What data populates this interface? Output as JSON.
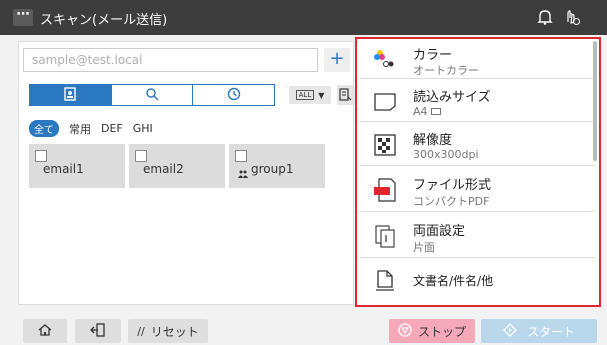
{
  "header": {
    "menu_label": "⋯",
    "title": "スキャン(メール送信)",
    "icons": [
      "bell-icon",
      "touch-info-icon"
    ]
  },
  "address": {
    "placeholder": "sample@test.local",
    "add_label": "+"
  },
  "tabs": [
    {
      "icon": "address-book-icon",
      "active": true
    },
    {
      "icon": "search-icon",
      "active": false
    },
    {
      "icon": "history-icon",
      "active": false
    }
  ],
  "view_select": {
    "box": "ALL",
    "arrow": "▼"
  },
  "filters": [
    "全て",
    "常用",
    "DEF",
    "GHI"
  ],
  "destinations": [
    {
      "label": "email1"
    },
    {
      "label": "email2"
    },
    {
      "label": "group1",
      "icon": "group-icon"
    }
  ],
  "settings": [
    {
      "label": "カラー",
      "value": "オートカラー",
      "icon": "color-icon"
    },
    {
      "label": "読込みサイズ",
      "value": "A4",
      "icon": "paper-size-icon"
    },
    {
      "label": "解像度",
      "value": "300x300dpi",
      "icon": "resolution-icon"
    },
    {
      "label": "ファイル形式",
      "value": "コンパクトPDF",
      "icon": "pdf-icon"
    },
    {
      "label": "両面設定",
      "value": "片面",
      "icon": "duplex-icon"
    },
    {
      "label": "文書名/件名/他",
      "value": "",
      "icon": "document-icon"
    }
  ],
  "bottom": {
    "reset_label": "リセット",
    "stop_label": "ストップ",
    "start_label": "スタート"
  },
  "colors": {
    "accent": "#2a78c0",
    "highlight_border": "#e0262e",
    "stop": "#f4a8b8",
    "start": "#b9d8ec"
  }
}
